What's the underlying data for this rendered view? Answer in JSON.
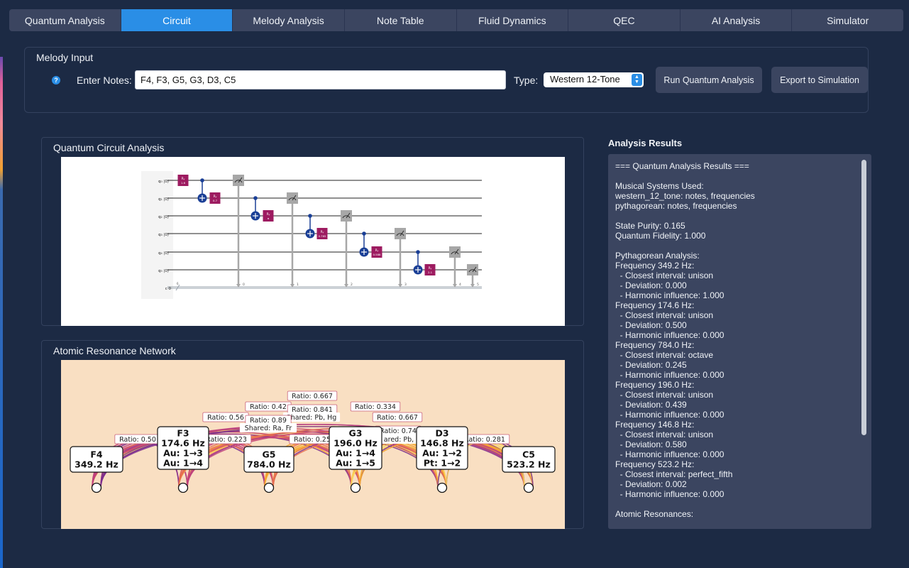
{
  "tabs": [
    {
      "label": "Quantum Analysis",
      "active": false
    },
    {
      "label": "Circuit",
      "active": true
    },
    {
      "label": "Melody Analysis",
      "active": false
    },
    {
      "label": "Note Table",
      "active": false
    },
    {
      "label": "Fluid Dynamics",
      "active": false
    },
    {
      "label": "QEC",
      "active": false
    },
    {
      "label": "AI Analysis",
      "active": false
    },
    {
      "label": "Simulator",
      "active": false
    }
  ],
  "melody_input": {
    "title": "Melody Input",
    "help_icon": "question-circle-icon",
    "notes_label": "Enter Notes:",
    "notes_value": "F4, F3, G5, G3, D3, C5",
    "type_label": "Type:",
    "type_value": "Western 12-Tone",
    "run_button": "Run Quantum Analysis",
    "export_button": "Export to Simulation"
  },
  "circuit": {
    "title": "Quantum Circuit Analysis",
    "qubit_labels": [
      "q₀ |0⟩",
      "q₁ |0⟩",
      "q₂ |0⟩",
      "q₃ |0⟩",
      "q₄ |0⟩",
      "q₅ |0⟩"
    ],
    "classical_label": "c 0",
    "classical_bits": "6",
    "measure_indices": [
      "0",
      "1",
      "2",
      "3",
      "4",
      "5"
    ],
    "gate_label": "Rᵧ",
    "gate_params": [
      "1.6",
      "0.7",
      "π",
      "0.765",
      "0.588",
      "2.1"
    ],
    "colors": {
      "gate": "#9d1b60",
      "cnot": "#1a3f96",
      "measure": "#a7a7a7"
    }
  },
  "atomic": {
    "title": "Atomic Resonance Network",
    "nodes": [
      {
        "lines": [
          "F4",
          "349.2 Hz"
        ]
      },
      {
        "lines": [
          "F3",
          "174.6 Hz",
          "Au: 1→3",
          "Au: 1→4"
        ]
      },
      {
        "lines": [
          "G5",
          "784.0 Hz"
        ]
      },
      {
        "lines": [
          "G3",
          "196.0 Hz",
          "Au: 1→4",
          "Au: 1→5"
        ]
      },
      {
        "lines": [
          "D3",
          "146.8 Hz",
          "Au: 1→2",
          "Pt: 1→2"
        ]
      },
      {
        "lines": [
          "C5",
          "523.2 Hz"
        ]
      }
    ],
    "edge_labels": [
      "Ratio: 0.667",
      "Ratio: 0.42",
      "Ratio: 0.841",
      "Ratio: 0.334",
      "Shared: Pb, Hg",
      "Ratio: 0.56",
      "Ratio: 0.89",
      "Ratio: 0.667",
      "Shared: Ra, Fr",
      "Ratio: 0.50",
      "Ratio: 0.223",
      "Ratio: 0.25",
      "Ratio: 0.74",
      "ared: Pb,",
      "Ratio: 0.281"
    ],
    "colors": {
      "background": "#f9dfc2",
      "edges": [
        "#7b2d8e",
        "#c2407a",
        "#e86f4e",
        "#f4a52c",
        "#f9d25b"
      ]
    }
  },
  "results": {
    "title": "Analysis Results",
    "lines": [
      "=== Quantum Analysis Results ===",
      "",
      "Musical Systems Used:",
      "western_12_tone: notes, frequencies",
      "pythagorean: notes, frequencies",
      "",
      "State Purity: 0.165",
      "Quantum Fidelity: 1.000",
      "",
      "Pythagorean Analysis:",
      "Frequency 349.2 Hz:",
      "  - Closest interval: unison",
      "  - Deviation: 0.000",
      "  - Harmonic influence: 1.000",
      "Frequency 174.6 Hz:",
      "  - Closest interval: unison",
      "  - Deviation: 0.500",
      "  - Harmonic influence: 0.000",
      "Frequency 784.0 Hz:",
      "  - Closest interval: octave",
      "  - Deviation: 0.245",
      "  - Harmonic influence: 0.000",
      "Frequency 196.0 Hz:",
      "  - Closest interval: unison",
      "  - Deviation: 0.439",
      "  - Harmonic influence: 0.000",
      "Frequency 146.8 Hz:",
      "  - Closest interval: unison",
      "  - Deviation: 0.580",
      "  - Harmonic influence: 0.000",
      "Frequency 523.2 Hz:",
      "  - Closest interval: perfect_fifth",
      "  - Deviation: 0.002",
      "  - Harmonic influence: 0.000",
      "",
      "Atomic Resonances:"
    ]
  }
}
